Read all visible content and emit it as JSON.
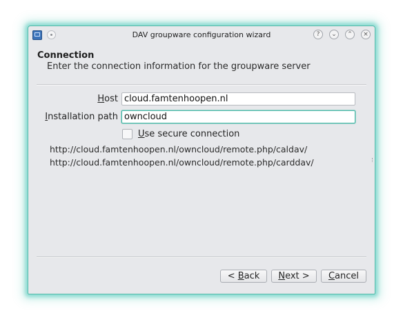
{
  "window": {
    "title": "DAV groupware configuration wizard",
    "accent_color": "#4fb9a9",
    "titlebar_buttons": [
      {
        "name": "help-icon",
        "glyph": "?"
      },
      {
        "name": "minimize-icon",
        "glyph": "⌄"
      },
      {
        "name": "maximize-icon",
        "glyph": "⌃"
      },
      {
        "name": "close-icon",
        "glyph": "×"
      }
    ]
  },
  "header": {
    "title": "Connection",
    "subtitle": "Enter the connection information for the groupware server"
  },
  "form": {
    "host_label_mnemonic": "H",
    "host_label_rest": "ost",
    "host_value": "cloud.famtenhoopen.nl",
    "path_label_mnemonic": "I",
    "path_label_rest": "nstallation path",
    "path_value": "owncloud",
    "secure_label_mnemonic": "U",
    "secure_label_rest": "se secure connection",
    "secure_checked": false
  },
  "urls": [
    "http://cloud.famtenhoopen.nl/owncloud/remote.php/caldav/",
    "http://cloud.famtenhoopen.nl/owncloud/remote.php/carddav/"
  ],
  "buttons": {
    "back_prefix": "< ",
    "back_mnemonic": "B",
    "back_rest": "ack",
    "next_mnemonic": "N",
    "next_rest": "ext >",
    "cancel_mnemonic": "C",
    "cancel_rest": "ancel"
  }
}
